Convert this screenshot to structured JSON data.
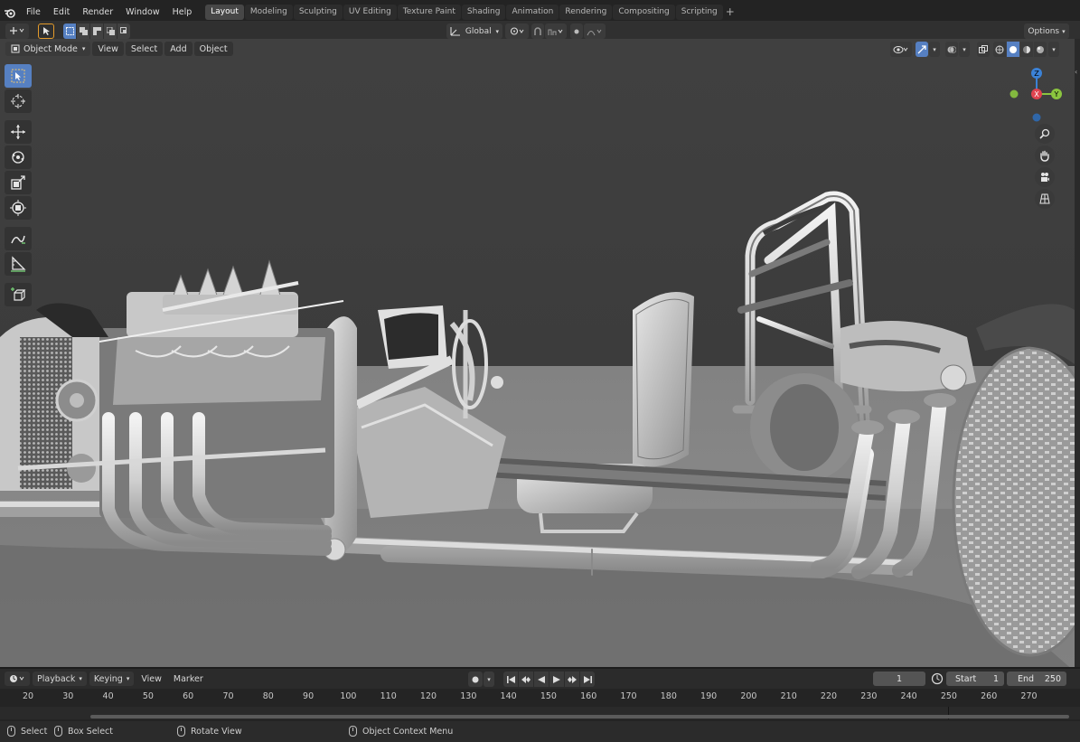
{
  "menus": [
    "File",
    "Edit",
    "Render",
    "Window",
    "Help"
  ],
  "workspace_tabs": [
    {
      "label": "Layout",
      "active": true
    },
    {
      "label": "Modeling",
      "active": false
    },
    {
      "label": "Sculpting",
      "active": false
    },
    {
      "label": "UV Editing",
      "active": false
    },
    {
      "label": "Texture Paint",
      "active": false
    },
    {
      "label": "Shading",
      "active": false
    },
    {
      "label": "Animation",
      "active": false
    },
    {
      "label": "Rendering",
      "active": false
    },
    {
      "label": "Compositing",
      "active": false
    },
    {
      "label": "Scripting",
      "active": false
    }
  ],
  "tool_header": {
    "transform_orientation": "Global",
    "options_label": "Options"
  },
  "viewport_header": {
    "mode": "Object Mode",
    "view": "View",
    "select": "Select",
    "add": "Add",
    "object": "Object"
  },
  "gizmo_axes": {
    "z": "Z",
    "x": "X",
    "y": "Y"
  },
  "timeline": {
    "playback": "Playback",
    "keying": "Keying",
    "view": "View",
    "marker": "Marker",
    "current_frame": "1",
    "start_label": "Start",
    "start": "1",
    "end_label": "End",
    "end": "250",
    "ticks": [
      "20",
      "30",
      "40",
      "50",
      "60",
      "70",
      "80",
      "90",
      "100",
      "110",
      "120",
      "130",
      "140",
      "150",
      "160",
      "170",
      "180",
      "190",
      "200",
      "210",
      "220",
      "230",
      "240",
      "250",
      "260",
      "270"
    ]
  },
  "status": {
    "select": "Select",
    "box_select": "Box Select",
    "rotate_view": "Rotate View",
    "context_menu": "Object Context Menu"
  },
  "colors": {
    "accent": "#5680c2",
    "active_tab": "#474747",
    "viewport_bg": "#3f3f3f",
    "axis_x": "#e0434f",
    "axis_y": "#8bc53f",
    "axis_z": "#3b82d6"
  }
}
